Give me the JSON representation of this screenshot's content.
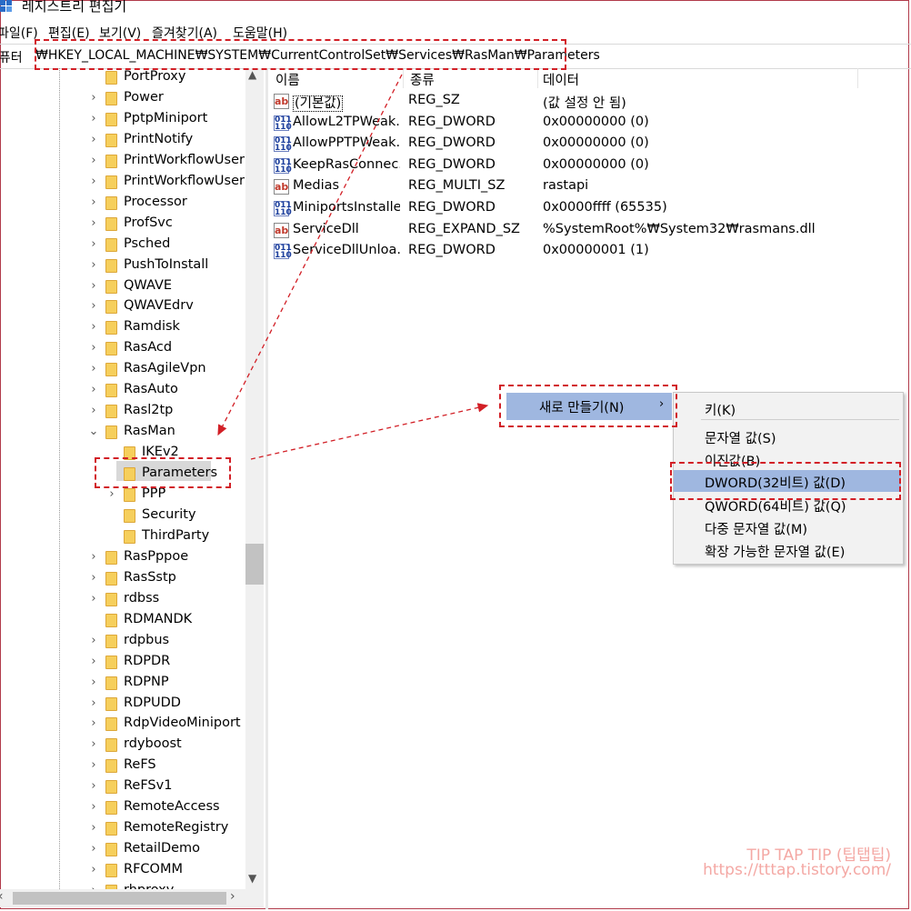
{
  "window": {
    "title": "레지스트리 편집기"
  },
  "menu": [
    "파일(F)",
    "편집(E)",
    "보기(V)",
    "즐겨찾기(A)",
    "도움말(H)"
  ],
  "address": {
    "label": "컴퓨터",
    "path": "₩HKEY_LOCAL_MACHINE₩SYSTEM₩CurrentControlSet₩Services₩RasMan₩Parameters"
  },
  "tree": {
    "items": [
      {
        "label": "PortProxy",
        "expander": ""
      },
      {
        "label": "Power",
        "expander": "›"
      },
      {
        "label": "PptpMiniport",
        "expander": "›"
      },
      {
        "label": "PrintNotify",
        "expander": "›"
      },
      {
        "label": "PrintWorkflowUserSv",
        "expander": "›"
      },
      {
        "label": "PrintWorkflowUserSv",
        "expander": "›"
      },
      {
        "label": "Processor",
        "expander": "›"
      },
      {
        "label": "ProfSvc",
        "expander": "›"
      },
      {
        "label": "Psched",
        "expander": "›"
      },
      {
        "label": "PushToInstall",
        "expander": "›"
      },
      {
        "label": "QWAVE",
        "expander": "›"
      },
      {
        "label": "QWAVEdrv",
        "expander": "›"
      },
      {
        "label": "Ramdisk",
        "expander": "›"
      },
      {
        "label": "RasAcd",
        "expander": "›"
      },
      {
        "label": "RasAgileVpn",
        "expander": "›"
      },
      {
        "label": "RasAuto",
        "expander": "›"
      },
      {
        "label": "Rasl2tp",
        "expander": "›"
      },
      {
        "label": "RasMan",
        "expander": "⌄"
      },
      {
        "label": "IKEv2",
        "expander": "",
        "child": true
      },
      {
        "label": "Parameters",
        "expander": "",
        "child": true,
        "selected": true
      },
      {
        "label": "PPP",
        "expander": "›",
        "child": true
      },
      {
        "label": "Security",
        "expander": "",
        "child": true
      },
      {
        "label": "ThirdParty",
        "expander": "",
        "child": true
      },
      {
        "label": "RasPppoe",
        "expander": "›"
      },
      {
        "label": "RasSstp",
        "expander": "›"
      },
      {
        "label": "rdbss",
        "expander": "›"
      },
      {
        "label": "RDMANDK",
        "expander": ""
      },
      {
        "label": "rdpbus",
        "expander": "›"
      },
      {
        "label": "RDPDR",
        "expander": "›"
      },
      {
        "label": "RDPNP",
        "expander": "›"
      },
      {
        "label": "RDPUDD",
        "expander": "›"
      },
      {
        "label": "RdpVideoMiniport",
        "expander": "›"
      },
      {
        "label": "rdyboost",
        "expander": "›"
      },
      {
        "label": "ReFS",
        "expander": "›"
      },
      {
        "label": "ReFSv1",
        "expander": "›"
      },
      {
        "label": "RemoteAccess",
        "expander": "›"
      },
      {
        "label": "RemoteRegistry",
        "expander": "›"
      },
      {
        "label": "RetailDemo",
        "expander": "›"
      },
      {
        "label": "RFCOMM",
        "expander": "›"
      },
      {
        "label": "rhproxy",
        "expander": "›"
      }
    ]
  },
  "list": {
    "columns": [
      "이름",
      "종류",
      "데이터"
    ],
    "rows": [
      {
        "icon": "ab",
        "name": "(기본값)",
        "type": "REG_SZ",
        "data": "(값 설정 안 됨)"
      },
      {
        "icon": "bin",
        "name": "AllowL2TPWeak...",
        "type": "REG_DWORD",
        "data": "0x00000000 (0)"
      },
      {
        "icon": "bin",
        "name": "AllowPPTPWeak...",
        "type": "REG_DWORD",
        "data": "0x00000000 (0)"
      },
      {
        "icon": "bin",
        "name": "KeepRasConnec...",
        "type": "REG_DWORD",
        "data": "0x00000000 (0)"
      },
      {
        "icon": "ab",
        "name": "Medias",
        "type": "REG_MULTI_SZ",
        "data": "rastapi"
      },
      {
        "icon": "bin",
        "name": "MiniportsInstalled",
        "type": "REG_DWORD",
        "data": "0x0000ffff (65535)"
      },
      {
        "icon": "ab",
        "name": "ServiceDll",
        "type": "REG_EXPAND_SZ",
        "data": "%SystemRoot%₩System32₩rasmans.dll"
      },
      {
        "icon": "bin",
        "name": "ServiceDllUnloa...",
        "type": "REG_DWORD",
        "data": "0x00000001 (1)"
      }
    ]
  },
  "context_menu": {
    "new_label": "새로 만들기(N)",
    "submenu": [
      "키(K)",
      "문자열 값(S)",
      "이진값(B)",
      "DWORD(32비트) 값(D)",
      "QWORD(64비트) 값(Q)",
      "다중 문자열 값(M)",
      "확장 가능한 문자열 값(E)"
    ]
  },
  "watermark": {
    "line1": "TIP TAP TIP (팁탭팁)",
    "line2": "https://tttap.tistory.com/"
  },
  "colors": {
    "highlight": "#9fb7e0",
    "annotation": "#d21f26",
    "folder": "#f6cf5c"
  }
}
